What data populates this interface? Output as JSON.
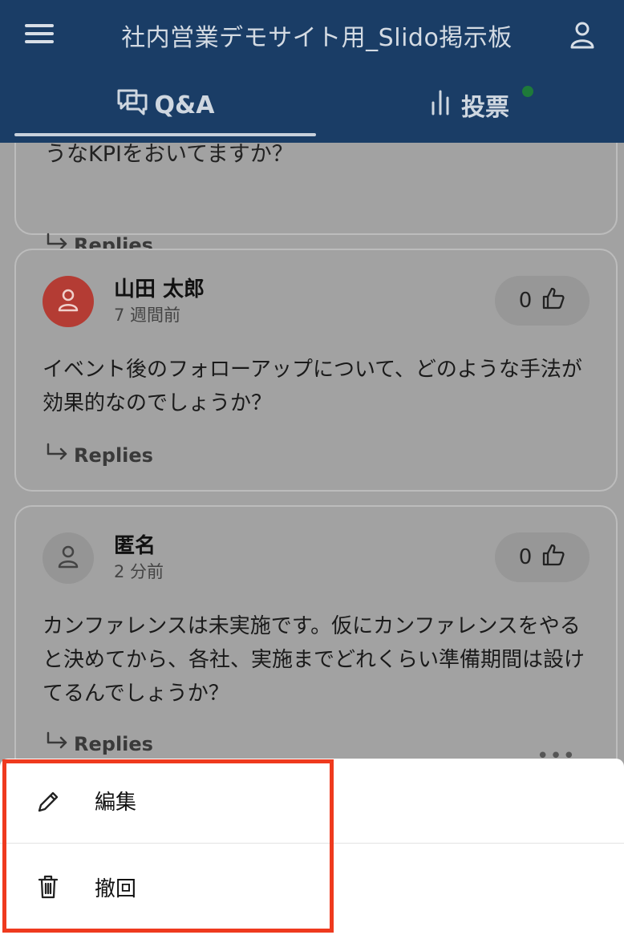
{
  "header": {
    "title": "社内営業デモサイト用_Slido掲示板",
    "tabs": [
      {
        "label": "Q&A",
        "icon": "chat-bubbles-icon",
        "active": true
      },
      {
        "label": "投票",
        "icon": "bar-chart-icon",
        "has_notification": true
      }
    ]
  },
  "feed": {
    "cards": [
      {
        "partial_text": "うなKPIをおいてますか？",
        "replies_label": "Replies"
      },
      {
        "author": "山田 太郎",
        "time": "7 週間前",
        "likes": "0",
        "question": "イベント後のフォローアップについて、どのような手法が効果的なのでしょうか？",
        "replies_label": "Replies",
        "avatar": "person-icon",
        "avatar_color": "#b43c34"
      },
      {
        "author": "匿名",
        "time": "2 分前",
        "likes": "0",
        "question": "カンファレンスは未実施です。仮にカンファレンスをやると決めてから、各社、実施までどれくらい準備期間は設けてるんでしょうか？",
        "replies_label": "Replies",
        "more_label": "•••",
        "avatar": "person-icon",
        "avatar_color": "#959595"
      }
    ]
  },
  "sheet": {
    "edit_label": "編集",
    "retract_label": "撤回"
  },
  "colors": {
    "header_bg": "#1a3d66",
    "highlight": "#ef3a1e",
    "notification": "#1e7a3a"
  }
}
